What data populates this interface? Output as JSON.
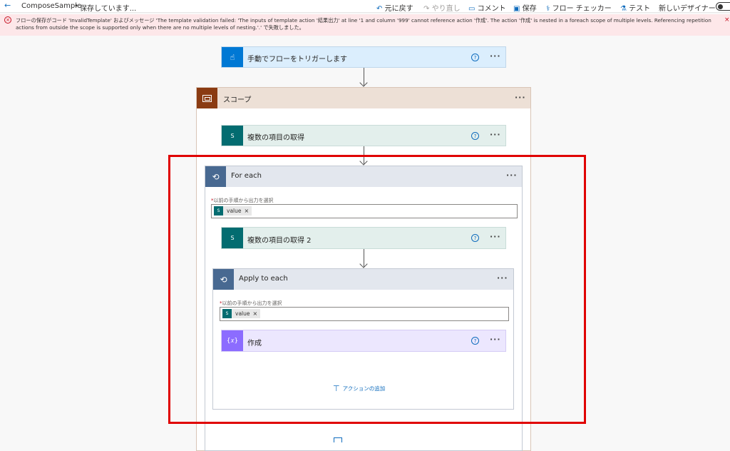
{
  "topbar": {
    "back_icon": "arrow-left-icon",
    "flow_name": "ComposeSample",
    "separator": "•",
    "status": "保存しています...",
    "undo": "元に戻す",
    "redo": "やり直し",
    "comment": "コメント",
    "save": "保存",
    "flow_checker": "フロー チェッカー",
    "test": "テスト",
    "new_designer": "新しいデザイナー"
  },
  "error": {
    "line1": "フローの保存がコード 'InvalidTemplate' およびメッセージ 'The template validation failed: 'The inputs of template action '結果出力' at line '1 and column '999' cannot reference action '作成'. The action '作成' is nested in a foreach scope of multiple levels. Referencing repetition",
    "line2": "actions from outside the scope is supported only when there are no multiple levels of nesting.'.' で失敗しました。"
  },
  "trigger": {
    "title": "手動でフローをトリガーします",
    "accent": "#0078d4"
  },
  "scope": {
    "title": "スコープ",
    "accent": "#8a3b12"
  },
  "get_items_1": {
    "title": "複数の項目の取得",
    "accent": "#036c70"
  },
  "foreach": {
    "title": "For each",
    "input_label": "以前の手順から出力を選択",
    "required_mark": "*",
    "token": "value",
    "accent": "#486991"
  },
  "get_items_2": {
    "title": "複数の項目の取得 2"
  },
  "apply_each": {
    "title": "Apply to each",
    "input_label": "以前の手順から出力を選択",
    "required_mark": "*",
    "token": "value"
  },
  "compose": {
    "title": "作成",
    "icon_text": "{𝑥}",
    "accent": "#8c6cff"
  },
  "add_action": "アクションの追加",
  "highlight_color": "#e00000"
}
